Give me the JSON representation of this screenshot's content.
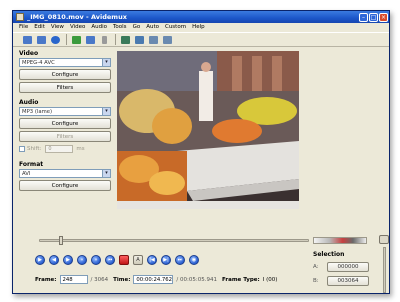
{
  "window": {
    "title": "_IMG_0810.mov - Avidemux"
  },
  "menu": [
    "File",
    "Edit",
    "View",
    "Video",
    "Audio",
    "Tools",
    "Go",
    "Auto",
    "Custom",
    "Help"
  ],
  "toolbar": {
    "icons": [
      "open-icon",
      "save-icon",
      "info-icon",
      "open-video-icon",
      "save-video-icon",
      "properties-icon",
      "next-keyframe-icon",
      "prev-keyframe-icon",
      "set-marker-a-icon",
      "set-marker-b-icon"
    ],
    "colors": [
      "#4a78c8",
      "#4a78c8",
      "#2a66cc",
      "#3c9b3c",
      "#4a78c8",
      "#9a9a9a",
      "#3a7a5a",
      "#4a7ab0",
      "#6a8ab0",
      "#6a8ab0"
    ]
  },
  "video_panel": {
    "label": "Video",
    "codec": "MPEG-4 AVC",
    "configure": "Configure",
    "filters": "Filters"
  },
  "audio_panel": {
    "label": "Audio",
    "codec": "MP3 (lame)",
    "configure": "Configure",
    "filters": "Filters",
    "shift_label": "Shift:",
    "shift_value": "0",
    "shift_unit": "ms"
  },
  "format_panel": {
    "label": "Format",
    "container": "AVI",
    "configure": "Configure"
  },
  "status": {
    "frame_label": "Frame:",
    "frame_value": "248",
    "frame_total": "/ 3064",
    "time_label": "Time:",
    "time_value": "00:00:24.762",
    "time_total": "/ 00:05:05.941",
    "frame_type_label": "Frame Type:",
    "frame_type_value": "I (00)"
  },
  "selection": {
    "label": "Selection",
    "a_label": "A:",
    "a_value": "000000",
    "b_label": "B:",
    "b_value": "003064"
  },
  "playback_position": 0.081,
  "accent_colors": {
    "titlebar": "#1c56c9",
    "window_bg": "#ece9d8",
    "stop_button": "#c01818"
  }
}
